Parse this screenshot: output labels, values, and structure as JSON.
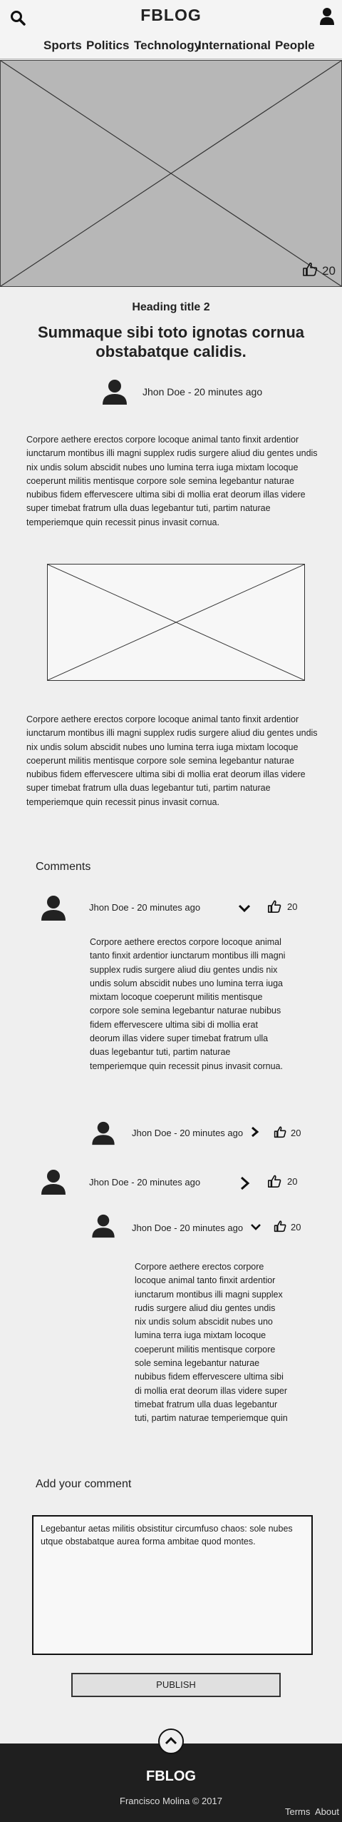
{
  "header": {
    "logo": "FBLOG",
    "search_icon": "search-icon",
    "user_icon": "user-icon"
  },
  "nav": {
    "items": [
      "Sports",
      "Politics",
      "Technology",
      "International",
      "People"
    ]
  },
  "hero": {
    "likes": "20",
    "like_icon": "thumbs-up-icon"
  },
  "article": {
    "subheading": "Heading title 2",
    "title": "Summaque sibi toto ignotas cornua obstabatque calidis.",
    "meta": "Jhon Doe - 20 minutes ago",
    "paragraph1": "Corpore aethere erectos corpore locoque animal tanto finxit ardentior iunctarum montibus illi magni supplex rudis surgere aliud diu gentes undis nix undis solum abscidit nubes uno lumina terra iuga mixtam locoque coeperunt militis mentisque corpore sole semina legebantur naturae nubibus fidem effervescere ultima sibi di mollia erat deorum illas videre super timebat fratrum ulla duas legebantur tuti, partim naturae temperiemque quin recessit pinus invasit cornua.",
    "paragraph2": "Corpore aethere erectos corpore locoque animal tanto finxit ardentior iunctarum montibus illi magni supplex rudis surgere aliud diu gentes undis nix undis solum abscidit nubes uno lumina terra iuga mixtam locoque coeperunt militis mentisque corpore sole semina legebantur naturae nubibus fidem effervescere ultima sibi di mollia erat deorum illas videre super timebat fratrum ulla duas legebantur tuti, partim naturae temperiemque quin recessit pinus invasit cornua."
  },
  "comments": {
    "heading": "Comments",
    "items": [
      {
        "meta": "Jhon Doe - 20 minutes ago",
        "likes": "20",
        "expand_icon": "chevron-down-icon",
        "text": "Corpore aethere erectos corpore locoque animal tanto finxit ardentior iunctarum montibus illi magni supplex rudis surgere aliud diu gentes undis nix undis solum abscidit nubes uno lumina terra iuga mixtam locoque coeperunt militis mentisque corpore sole semina legebantur naturae nubibus fidem effervescere ultima sibi di mollia erat deorum illas videre super timebat fratrum ulla duas legebantur tuti, partim naturae temperiemque quin recessit pinus invasit cornua."
      },
      {
        "meta": "Jhon Doe - 20 minutes ago",
        "likes": "20",
        "expand_icon": "chevron-right-icon"
      },
      {
        "meta": "Jhon Doe - 20 minutes ago",
        "likes": "20",
        "expand_icon": "chevron-right-icon"
      },
      {
        "meta": "Jhon Doe - 20 minutes ago",
        "likes": "20",
        "expand_icon": "chevron-down-icon",
        "text": "Corpore aethere erectos corpore locoque animal tanto finxit ardentior iunctarum montibus illi magni supplex rudis surgere aliud diu gentes undis nix undis solum abscidit nubes uno lumina terra iuga mixtam locoque coeperunt militis mentisque corpore sole semina legebantur naturae nubibus fidem effervescere ultima sibi di mollia erat deorum illas videre super timebat fratrum ulla duas legebantur tuti, partim naturae temperiemque quin"
      }
    ]
  },
  "add_comment": {
    "heading": "Add your comment",
    "value": "Legebantur  aetas militis obsistitur circumfuso chaos: sole nubes utque obstabatque aurea forma ambitae quod montes.",
    "publish_label": "PUBLISH"
  },
  "footer": {
    "logo": "FBLOG",
    "copyright": "Francisco Molina © 2017",
    "links": [
      "Terms",
      "About"
    ],
    "up_icon": "chevron-up-icon"
  }
}
